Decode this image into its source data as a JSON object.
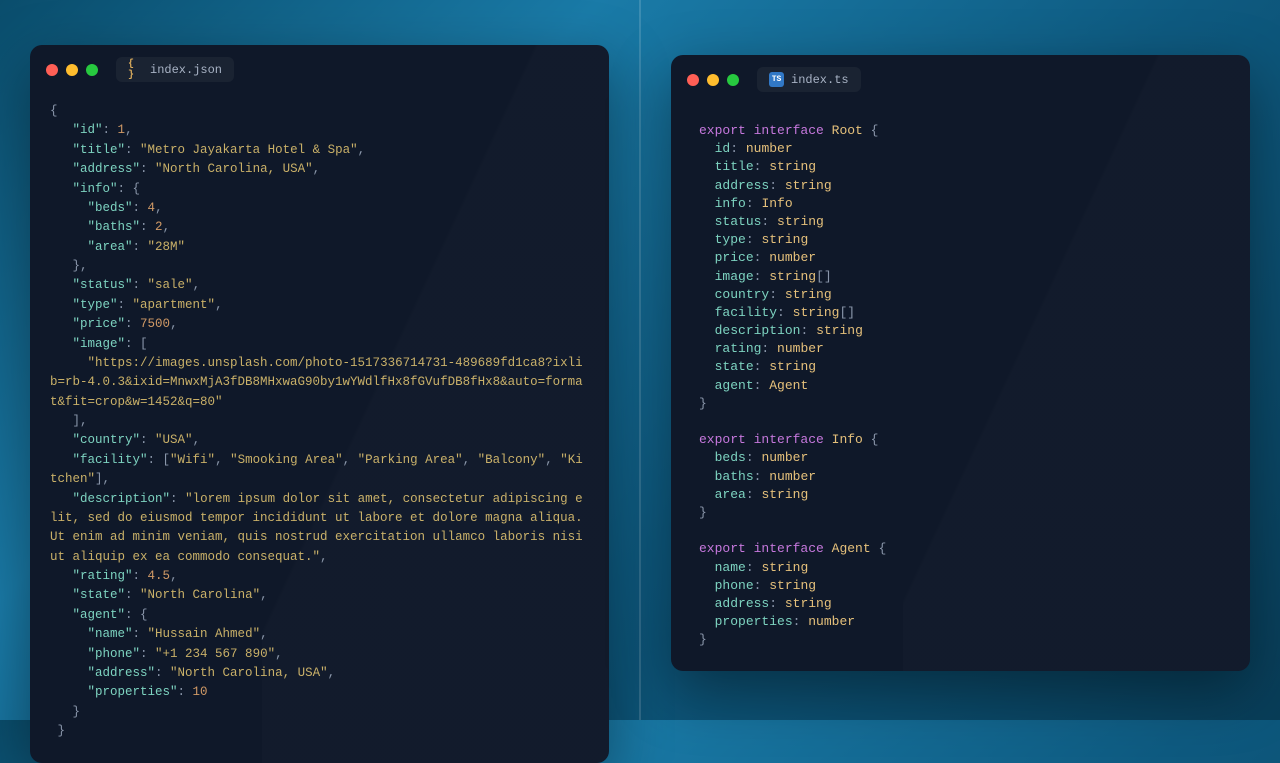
{
  "left": {
    "filename": "index.json",
    "code_html": "<span class='p'>{</span>\n   <span class='k'>\"id\"</span><span class='p'>: </span><span class='n'>1</span><span class='p'>,</span>\n   <span class='k'>\"title\"</span><span class='p'>: </span><span class='s'>\"Metro Jayakarta Hotel & Spa\"</span><span class='p'>,</span>\n   <span class='k'>\"address\"</span><span class='p'>: </span><span class='s'>\"North Carolina, USA\"</span><span class='p'>,</span>\n   <span class='k'>\"info\"</span><span class='p'>: {</span>\n     <span class='k'>\"beds\"</span><span class='p'>: </span><span class='n'>4</span><span class='p'>,</span>\n     <span class='k'>\"baths\"</span><span class='p'>: </span><span class='n'>2</span><span class='p'>,</span>\n     <span class='k'>\"area\"</span><span class='p'>: </span><span class='s'>\"28M\"</span>\n   <span class='p'>},</span>\n   <span class='k'>\"status\"</span><span class='p'>: </span><span class='s'>\"sale\"</span><span class='p'>,</span>\n   <span class='k'>\"type\"</span><span class='p'>: </span><span class='s'>\"apartment\"</span><span class='p'>,</span>\n   <span class='k'>\"price\"</span><span class='p'>: </span><span class='n'>7500</span><span class='p'>,</span>\n   <span class='k'>\"image\"</span><span class='p'>: [</span>\n     <span class='s'>\"https://images.unsplash.com/photo-1517336714731-489689fd1ca8?ixlib=rb-4.0.3&ixid=MnwxMjA3fDB8MHxwaG90by1wYWdlfHx8fGVufDB8fHx8&auto=format&fit=crop&w=1452&q=80\"</span>\n   <span class='p'>],</span>\n   <span class='k'>\"country\"</span><span class='p'>: </span><span class='s'>\"USA\"</span><span class='p'>,</span>\n   <span class='k'>\"facility\"</span><span class='p'>: [</span><span class='s'>\"Wifi\"</span><span class='p'>, </span><span class='s'>\"Smooking Area\"</span><span class='p'>, </span><span class='s'>\"Parking Area\"</span><span class='p'>, </span><span class='s'>\"Balcony\"</span><span class='p'>, </span><span class='s'>\"Kitchen\"</span><span class='p'>],</span>\n   <span class='k'>\"description\"</span><span class='p'>: </span><span class='s'>\"lorem ipsum dolor sit amet, consectetur adipiscing elit, sed do eiusmod tempor incididunt ut labore et dolore magna aliqua. Ut enim ad minim veniam, quis nostrud exercitation ullamco laboris nisi ut aliquip ex ea commodo consequat.\"</span><span class='p'>,</span>\n   <span class='k'>\"rating\"</span><span class='p'>: </span><span class='n'>4.5</span><span class='p'>,</span>\n   <span class='k'>\"state\"</span><span class='p'>: </span><span class='s'>\"North Carolina\"</span><span class='p'>,</span>\n   <span class='k'>\"agent\"</span><span class='p'>: {</span>\n     <span class='k'>\"name\"</span><span class='p'>: </span><span class='s'>\"Hussain Ahmed\"</span><span class='p'>,</span>\n     <span class='k'>\"phone\"</span><span class='p'>: </span><span class='s'>\"+1 234 567 890\"</span><span class='p'>,</span>\n     <span class='k'>\"address\"</span><span class='p'>: </span><span class='s'>\"North Carolina, USA\"</span><span class='p'>,</span>\n     <span class='k'>\"properties\"</span><span class='p'>: </span><span class='n'>10</span>\n   <span class='p'>}</span>\n <span class='p'>}</span>"
  },
  "right": {
    "filename": "index.ts",
    "code_html": "<span class='kw'>export interface</span> <span class='ty'>Root</span> <span class='br'>{</span>\n  <span class='pr'>id</span><span class='p'>:</span> <span class='tp'>number</span>\n  <span class='pr'>title</span><span class='p'>:</span> <span class='tp'>string</span>\n  <span class='pr'>address</span><span class='p'>:</span> <span class='tp'>string</span>\n  <span class='pr'>info</span><span class='p'>:</span> <span class='ty'>Info</span>\n  <span class='pr'>status</span><span class='p'>:</span> <span class='tp'>string</span>\n  <span class='pr'>type</span><span class='p'>:</span> <span class='tp'>string</span>\n  <span class='pr'>price</span><span class='p'>:</span> <span class='tp'>number</span>\n  <span class='pr'>image</span><span class='p'>:</span> <span class='tp'>string</span><span class='br'>[]</span>\n  <span class='pr'>country</span><span class='p'>:</span> <span class='tp'>string</span>\n  <span class='pr'>facility</span><span class='p'>:</span> <span class='tp'>string</span><span class='br'>[]</span>\n  <span class='pr'>description</span><span class='p'>:</span> <span class='tp'>string</span>\n  <span class='pr'>rating</span><span class='p'>:</span> <span class='tp'>number</span>\n  <span class='pr'>state</span><span class='p'>:</span> <span class='tp'>string</span>\n  <span class='pr'>agent</span><span class='p'>:</span> <span class='ty'>Agent</span>\n<span class='br'>}</span>\n\n<span class='kw'>export interface</span> <span class='ty'>Info</span> <span class='br'>{</span>\n  <span class='pr'>beds</span><span class='p'>:</span> <span class='tp'>number</span>\n  <span class='pr'>baths</span><span class='p'>:</span> <span class='tp'>number</span>\n  <span class='pr'>area</span><span class='p'>:</span> <span class='tp'>string</span>\n<span class='br'>}</span>\n\n<span class='kw'>export interface</span> <span class='ty'>Agent</span> <span class='br'>{</span>\n  <span class='pr'>name</span><span class='p'>:</span> <span class='tp'>string</span>\n  <span class='pr'>phone</span><span class='p'>:</span> <span class='tp'>string</span>\n  <span class='pr'>address</span><span class='p'>:</span> <span class='tp'>string</span>\n  <span class='pr'>properties</span><span class='p'>:</span> <span class='tp'>number</span>\n<span class='br'>}</span>"
  }
}
